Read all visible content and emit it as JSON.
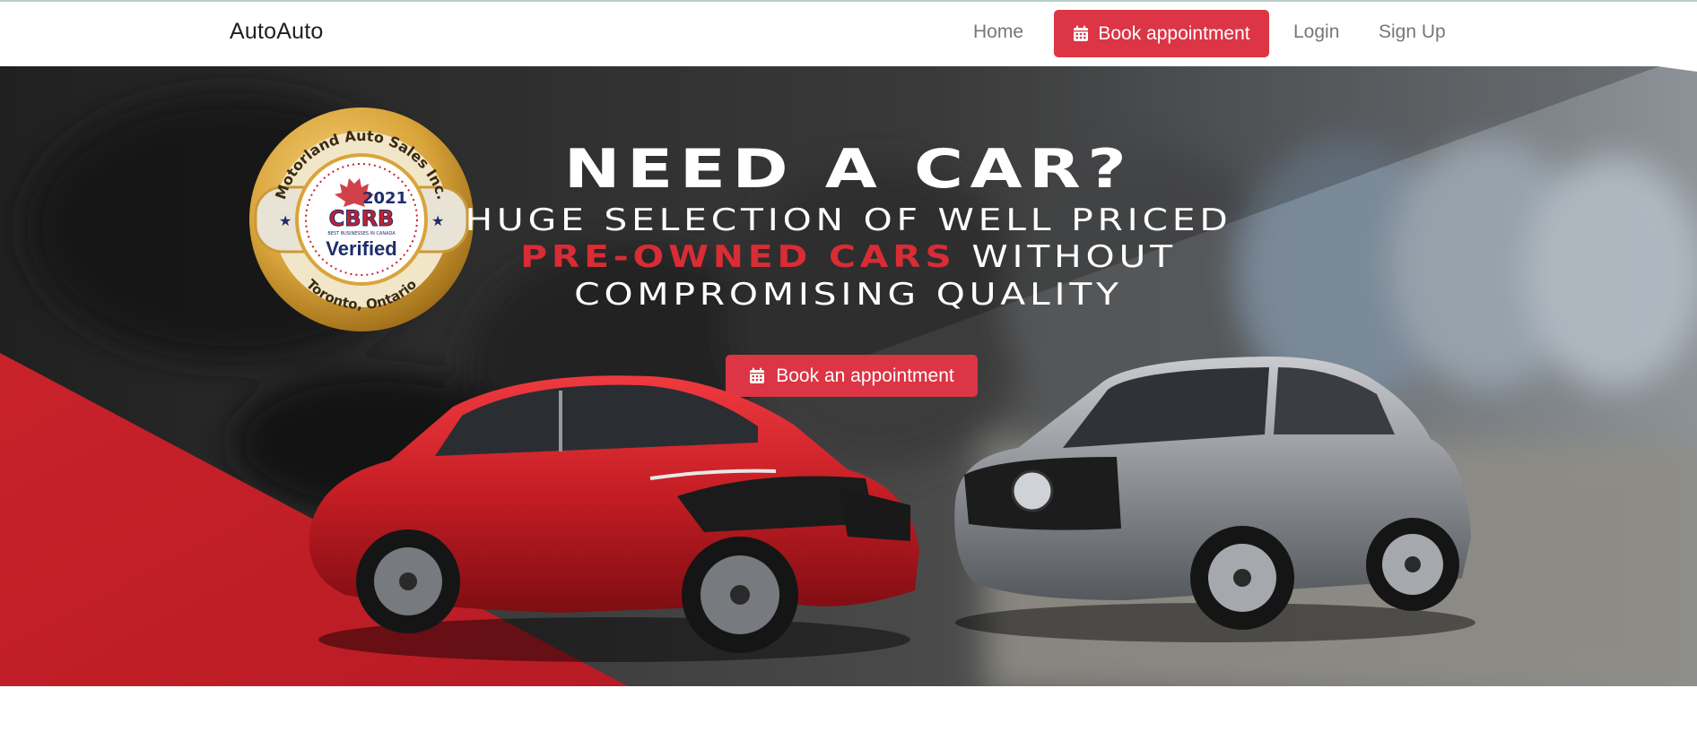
{
  "nav": {
    "brand": "AutoAuto",
    "home": "Home",
    "book": "Book appointment",
    "login": "Login",
    "signup": "Sign Up"
  },
  "hero": {
    "headline": "NEED A CAR?",
    "line1": "HUGE SELECTION OF WELL PRICED",
    "line2_highlight": "PRE-OWNED CARS",
    "line2_rest": " WITHOUT",
    "line3": "COMPROMISING QUALITY",
    "button": "Book an appointment"
  },
  "badge": {
    "ring_top": "Motorland Auto Sales Inc.",
    "year": "2021",
    "logo": "CBRB",
    "tagline": "BEST BUSINESSES IN CANADA",
    "verified": "Verified",
    "ring_bottom": "Toronto, Ontario"
  },
  "colors": {
    "accent": "#dc3545",
    "hero_red": "#c8202a",
    "gold": "#d9a43a"
  },
  "icons": {
    "calendar": "calendar-icon"
  }
}
